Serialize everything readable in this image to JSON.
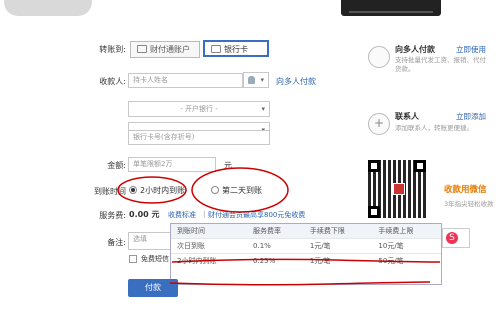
{
  "form": {
    "transfer_to_label": "转账到:",
    "tab_account": "财付通账户",
    "tab_card": "银行卡",
    "payee_label": "收款人:",
    "payee_placeholder": "持卡人姓名",
    "multi_payee_link": "向多人付款",
    "bank_select": "- 开户银行 -",
    "branch_select": "",
    "card_placeholder": "银行卡号(含存折号)",
    "amount_label": "金额:",
    "amount_placeholder": "单笔限额2万",
    "amount_unit": "元",
    "arrival_label": "到账时间",
    "arrival_option_1": "2小时内到账",
    "arrival_option_2": "第二天到账",
    "fee_label": "服务费:",
    "fee_value": "0.00 元",
    "fee_standard_link": "收费标准",
    "fee_member_link": "财付通会员最高享800元免收费",
    "note_label": "备注:",
    "note_placeholder": "选填",
    "free_sms_label": "免费短信",
    "pay_button": "付款"
  },
  "fee_table": {
    "headers": [
      "到账时间",
      "服务费率",
      "手续费下限",
      "手续费上限"
    ],
    "rows": [
      [
        "次日到账",
        "0.1%",
        "1元/笔",
        "10元/笔"
      ],
      [
        "2小时内到账",
        "0.25%",
        "1元/笔",
        "50元/笔"
      ]
    ]
  },
  "sidebar": {
    "multi_title": "向多人付款",
    "multi_link": "立即使用",
    "multi_desc": "支持批量代发工资、报销、代付货款。",
    "contacts_title": "联系人",
    "contacts_link": "立即添加",
    "contacts_desc": "添加联系人，转账更便捷。",
    "promo_title": "收款用微信",
    "promo_desc": "3年指尖轻松收款"
  },
  "colors": {
    "accent": "#3a6fbf",
    "annotation_red": "#c00000"
  }
}
